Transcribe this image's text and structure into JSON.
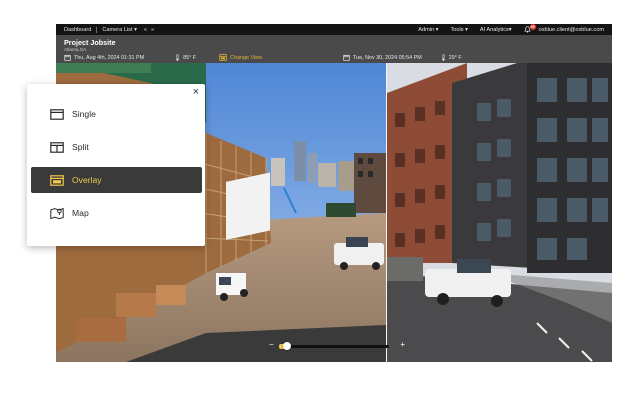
{
  "topnav": {
    "dashboard": "Dashboard",
    "camera_list": "Camera List ▾",
    "nav_prev": "«",
    "nav_next": "»",
    "admin": "Admin ▾",
    "tools": "Tools ▾",
    "ai": "AI Analytics▾",
    "notif_count": "99",
    "email": "oxblue.client@oxblue.com"
  },
  "project": {
    "title": "Project Jobsite",
    "location": "Atlanta,GA"
  },
  "left_meta": {
    "date": "Thu, Aug 4th, 2024 01:31 PM",
    "temp": "85° F",
    "change_view": "Change View"
  },
  "right_meta": {
    "date": "Tue, Nov 30, 2024 05:54 PM",
    "temp": "29° F"
  },
  "view_menu": {
    "close": "×",
    "items": [
      {
        "label": "Single",
        "icon": "single-view-icon",
        "active": false
      },
      {
        "label": "Split",
        "icon": "split-view-icon",
        "active": false
      },
      {
        "label": "Overlay",
        "icon": "overlay-view-icon",
        "active": true
      },
      {
        "label": "Map",
        "icon": "map-icon",
        "active": false
      }
    ]
  },
  "slider": {
    "minus": "−",
    "plus": "+",
    "value": 0.07
  },
  "colors": {
    "accent": "#f2c94c",
    "nav_bg": "#141414",
    "project_bar": "#4a4a4a",
    "active_item": "#3a3a3a"
  }
}
